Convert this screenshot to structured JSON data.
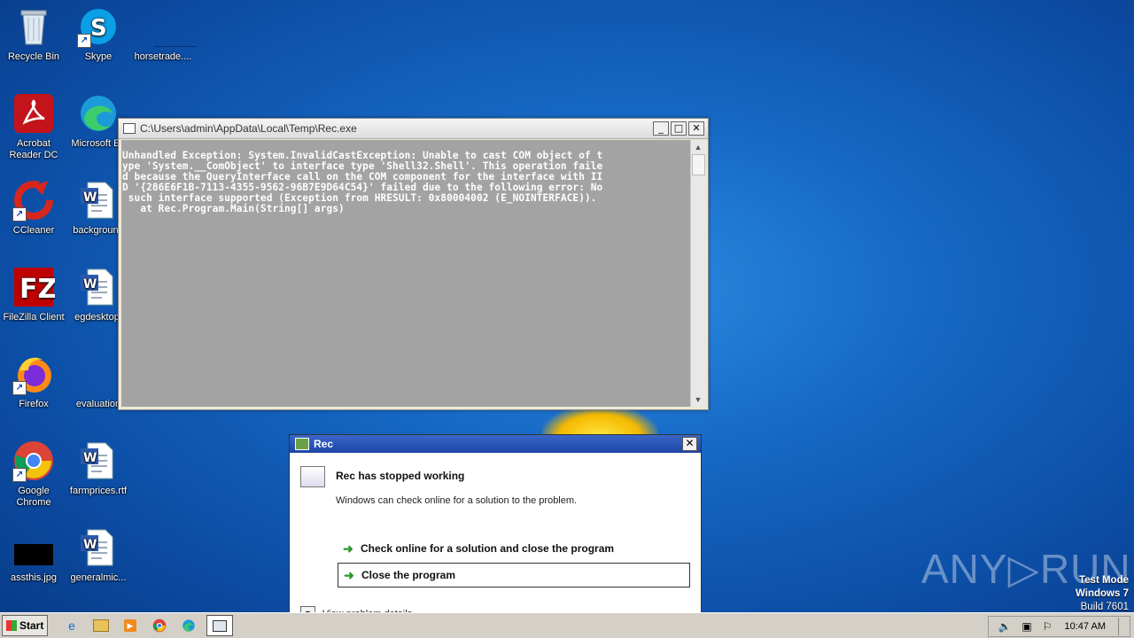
{
  "desktop": {
    "icons": [
      {
        "label": "Recycle Bin"
      },
      {
        "label": "Skype"
      },
      {
        "label": "horsetrade...."
      },
      {
        "label": "Acrobat Reader DC"
      },
      {
        "label": "Microsoft Ed"
      },
      {
        "label": "CCleaner"
      },
      {
        "label": "background"
      },
      {
        "label": "FileZilla Client"
      },
      {
        "label": "egdesktop."
      },
      {
        "label": "Firefox"
      },
      {
        "label": "evaluation"
      },
      {
        "label": "Google Chrome"
      },
      {
        "label": "farmprices.rtf"
      },
      {
        "label": "assthis.jpg"
      },
      {
        "label": "generalmic..."
      }
    ]
  },
  "console": {
    "title": "C:\\Users\\admin\\AppData\\Local\\Temp\\Rec.exe",
    "lines": [
      "Unhandled Exception: System.InvalidCastException: Unable to cast COM object of t",
      "ype 'System.__ComObject' to interface type 'Shell32.Shell'. This operation faile",
      "d because the QueryInterface call on the COM component for the interface with II",
      "D '{286E6F1B-7113-4355-9562-96B7E9D64C54}' failed due to the following error: No",
      " such interface supported (Exception from HRESULT: 0x80004002 (E_NOINTERFACE)).",
      "   at Rec.Program.Main(String[] args)"
    ],
    "buttons": {
      "minimize": "_",
      "maximize": "□",
      "close": "✕"
    }
  },
  "dialog": {
    "title": "Rec",
    "headline": "Rec has stopped working",
    "description": "Windows can check online for a solution to the problem.",
    "option_check_online": "Check online for a solution and close the program",
    "option_close": "Close the program",
    "details_label": "View problem details",
    "close": "✕"
  },
  "taskbar": {
    "start_label": "Start",
    "clock": "10:47 AM"
  },
  "watermark": {
    "brand": "ANY▷RUN",
    "test_mode": "Test Mode",
    "os": "Windows 7",
    "build": "Build 7601"
  }
}
